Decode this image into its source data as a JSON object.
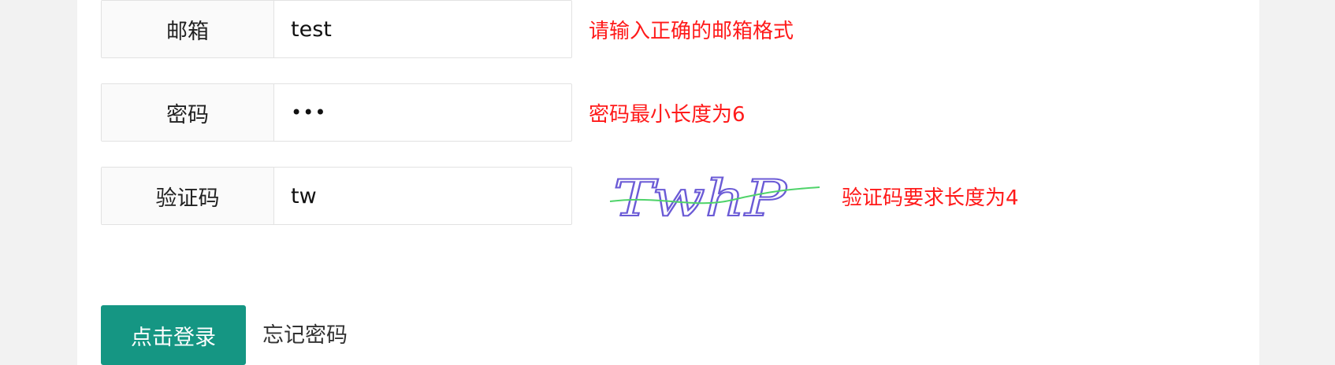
{
  "form": {
    "email": {
      "label": "邮箱",
      "value": "test",
      "error": "请输入正确的邮箱格式"
    },
    "password": {
      "label": "密码",
      "value": "•••",
      "error": "密码最小长度为6"
    },
    "captcha": {
      "label": "验证码",
      "value": "tw",
      "image_text": "TwhP",
      "error": "验证码要求长度为4"
    }
  },
  "actions": {
    "login_label": "点击登录",
    "forgot_label": "忘记密码"
  },
  "colors": {
    "error": "#ff1a1a",
    "primary": "#159683",
    "label_bg": "#fafafa",
    "border": "#e2e2e2"
  }
}
